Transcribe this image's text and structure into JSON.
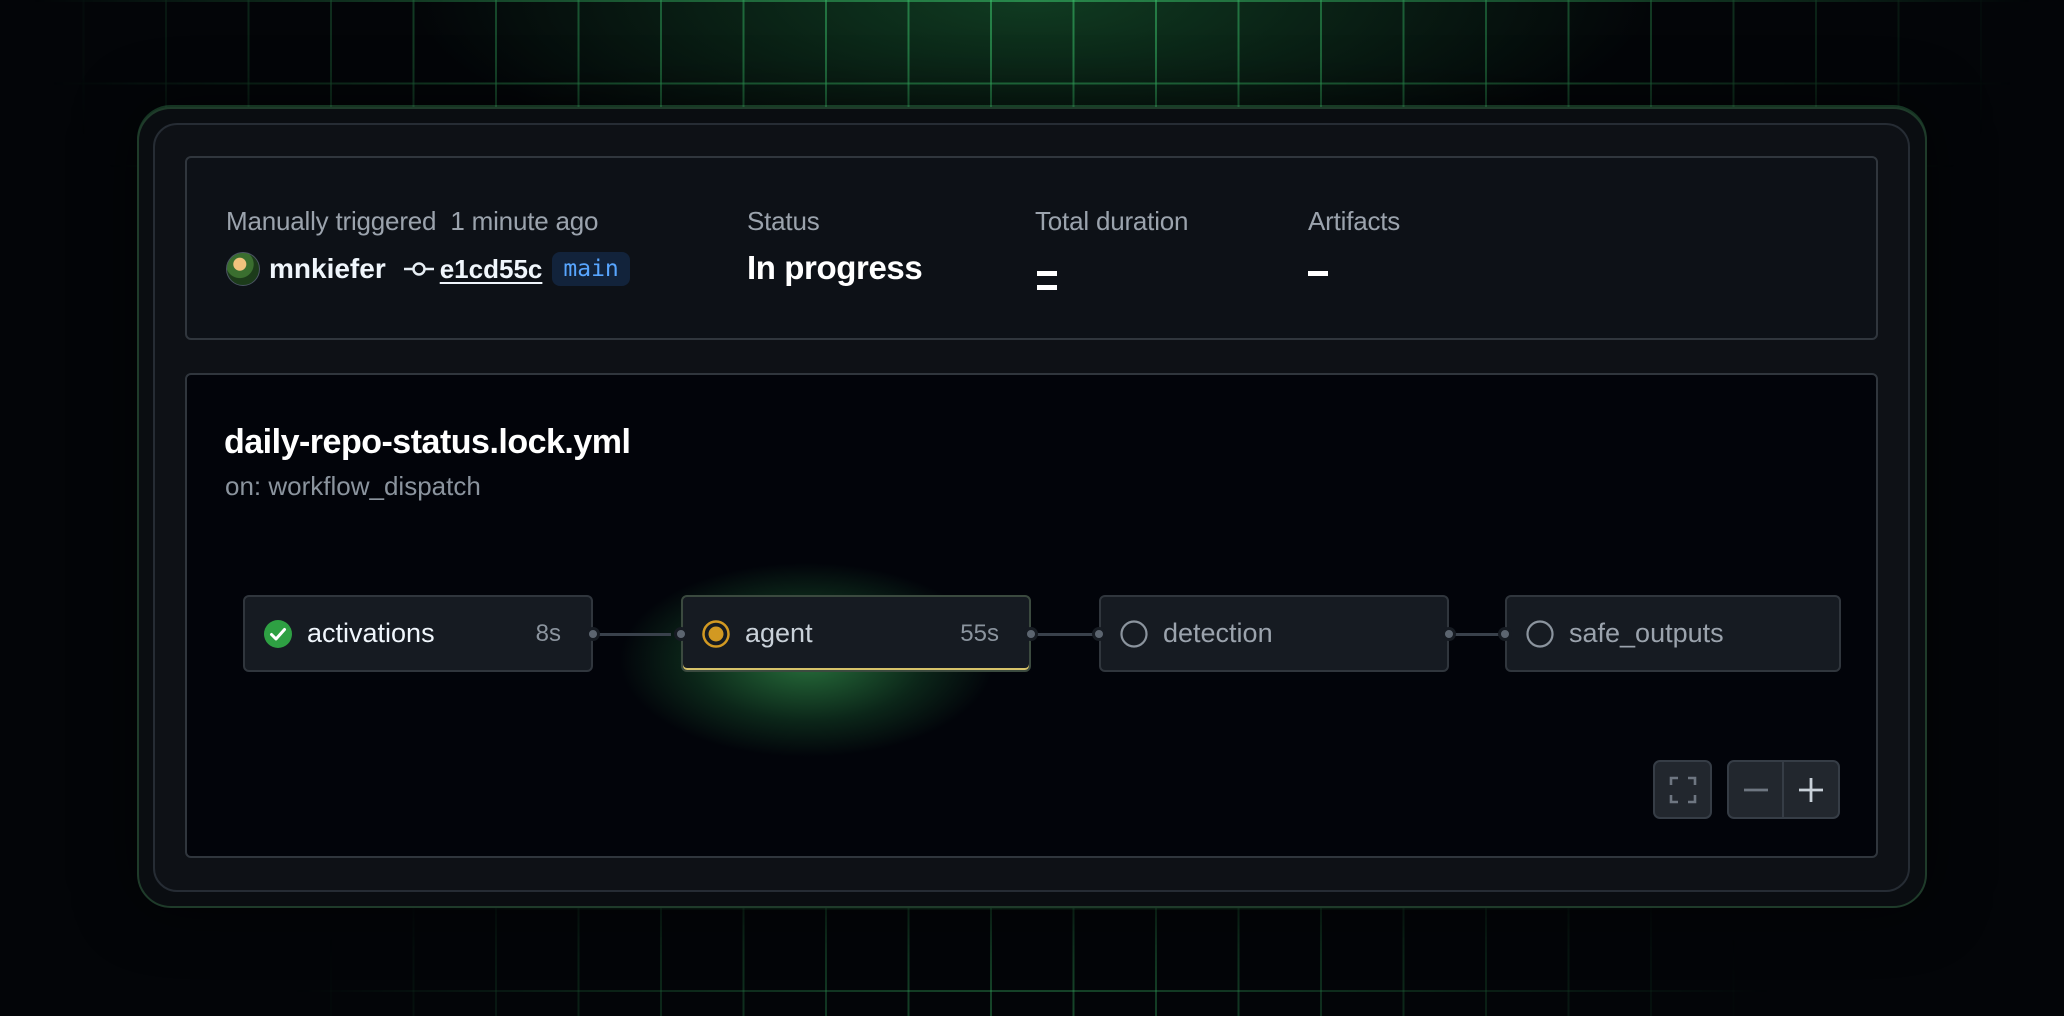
{
  "summary": {
    "trigger_label": "Manually triggered",
    "trigger_time": "1 minute ago",
    "user": "mnkiefer",
    "commit_sha": "e1cd55c",
    "branch": "main",
    "status_label": "Status",
    "status_value": "In progress",
    "duration_label": "Total duration",
    "artifacts_label": "Artifacts"
  },
  "workflow": {
    "file_name": "daily-repo-status.lock.yml",
    "trigger": "on: workflow_dispatch",
    "jobs": [
      {
        "name": "activations",
        "duration": "8s",
        "status": "success"
      },
      {
        "name": "agent",
        "duration": "55s",
        "status": "in_progress"
      },
      {
        "name": "detection",
        "duration": "",
        "status": "pending"
      },
      {
        "name": "safe_outputs",
        "duration": "",
        "status": "pending"
      }
    ]
  },
  "colors": {
    "success": "#2ea043",
    "in_progress": "#d29922",
    "pending": "#8b949e",
    "branch_text": "#58a6ff",
    "glow": "#3fb950"
  },
  "icons": {
    "success": "check-circle-icon",
    "in_progress": "dot-fill-icon",
    "pending": "circle-icon",
    "commit": "git-commit-icon",
    "fullscreen": "screen-full-icon",
    "zoom_out": "minus-icon",
    "zoom_in": "plus-icon"
  }
}
